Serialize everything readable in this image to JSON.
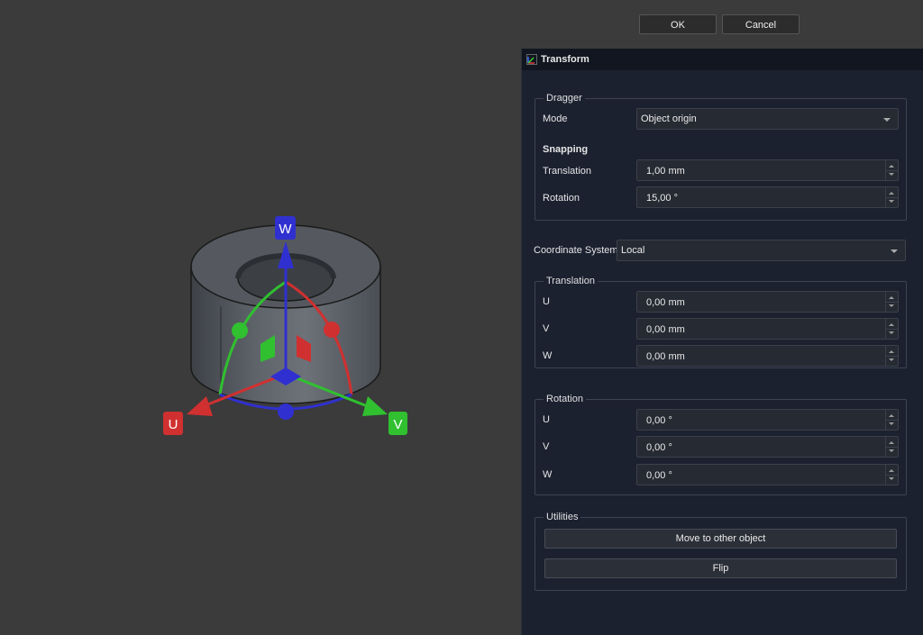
{
  "dialog_buttons": {
    "ok": "OK",
    "cancel": "Cancel"
  },
  "panel": {
    "title": "Transform"
  },
  "dragger": {
    "legend": "Dragger",
    "mode_label": "Mode",
    "mode_value": "Object origin",
    "snapping_heading": "Snapping",
    "translation_label": "Translation",
    "translation_value": "1,00 mm",
    "rotation_label": "Rotation",
    "rotation_value": "15,00 °"
  },
  "coordinate_system": {
    "label": "Coordinate System",
    "value": "Local"
  },
  "translation": {
    "legend": "Translation",
    "u_label": "U",
    "u_value": "0,00 mm",
    "v_label": "V",
    "v_value": "0,00 mm",
    "w_label": "W",
    "w_value": "0,00 mm"
  },
  "rotation": {
    "legend": "Rotation",
    "u_label": "U",
    "u_value": "0,00 °",
    "v_label": "V",
    "v_value": "0,00 °",
    "w_label": "W",
    "w_value": "0,00 °"
  },
  "utilities": {
    "legend": "Utilities",
    "move_label": "Move to other object",
    "flip_label": "Flip"
  },
  "gizmo": {
    "u_axis_label": "U",
    "v_axis_label": "V",
    "w_axis_label": "W",
    "colors": {
      "u": "#d03030",
      "v": "#30c030",
      "w": "#3030d0"
    }
  },
  "icons": {
    "panel_icon": "transform-icon"
  }
}
